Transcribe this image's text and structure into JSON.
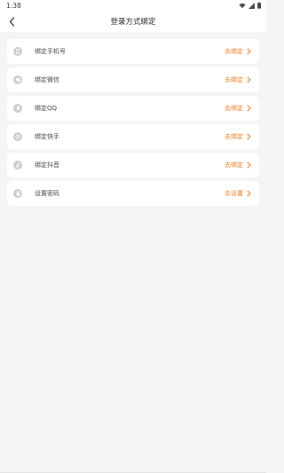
{
  "status_bar": {
    "time": "1:38"
  },
  "header": {
    "title": "登录方式绑定"
  },
  "rows": [
    {
      "label": "绑定手机号",
      "action": "去绑定",
      "icon": "phone-icon"
    },
    {
      "label": "绑定微信",
      "action": "去绑定",
      "icon": "wechat-icon"
    },
    {
      "label": "绑定QQ",
      "action": "去绑定",
      "icon": "qq-icon"
    },
    {
      "label": "绑定快手",
      "action": "去绑定",
      "icon": "kuaishou-icon"
    },
    {
      "label": "绑定抖音",
      "action": "去绑定",
      "icon": "douyin-icon"
    },
    {
      "label": "设置密码",
      "action": "去设置",
      "icon": "lock-icon"
    }
  ],
  "colors": {
    "accent": "#f07a1a",
    "icon_bg": "#cccccc",
    "background": "#f5f5f5"
  }
}
